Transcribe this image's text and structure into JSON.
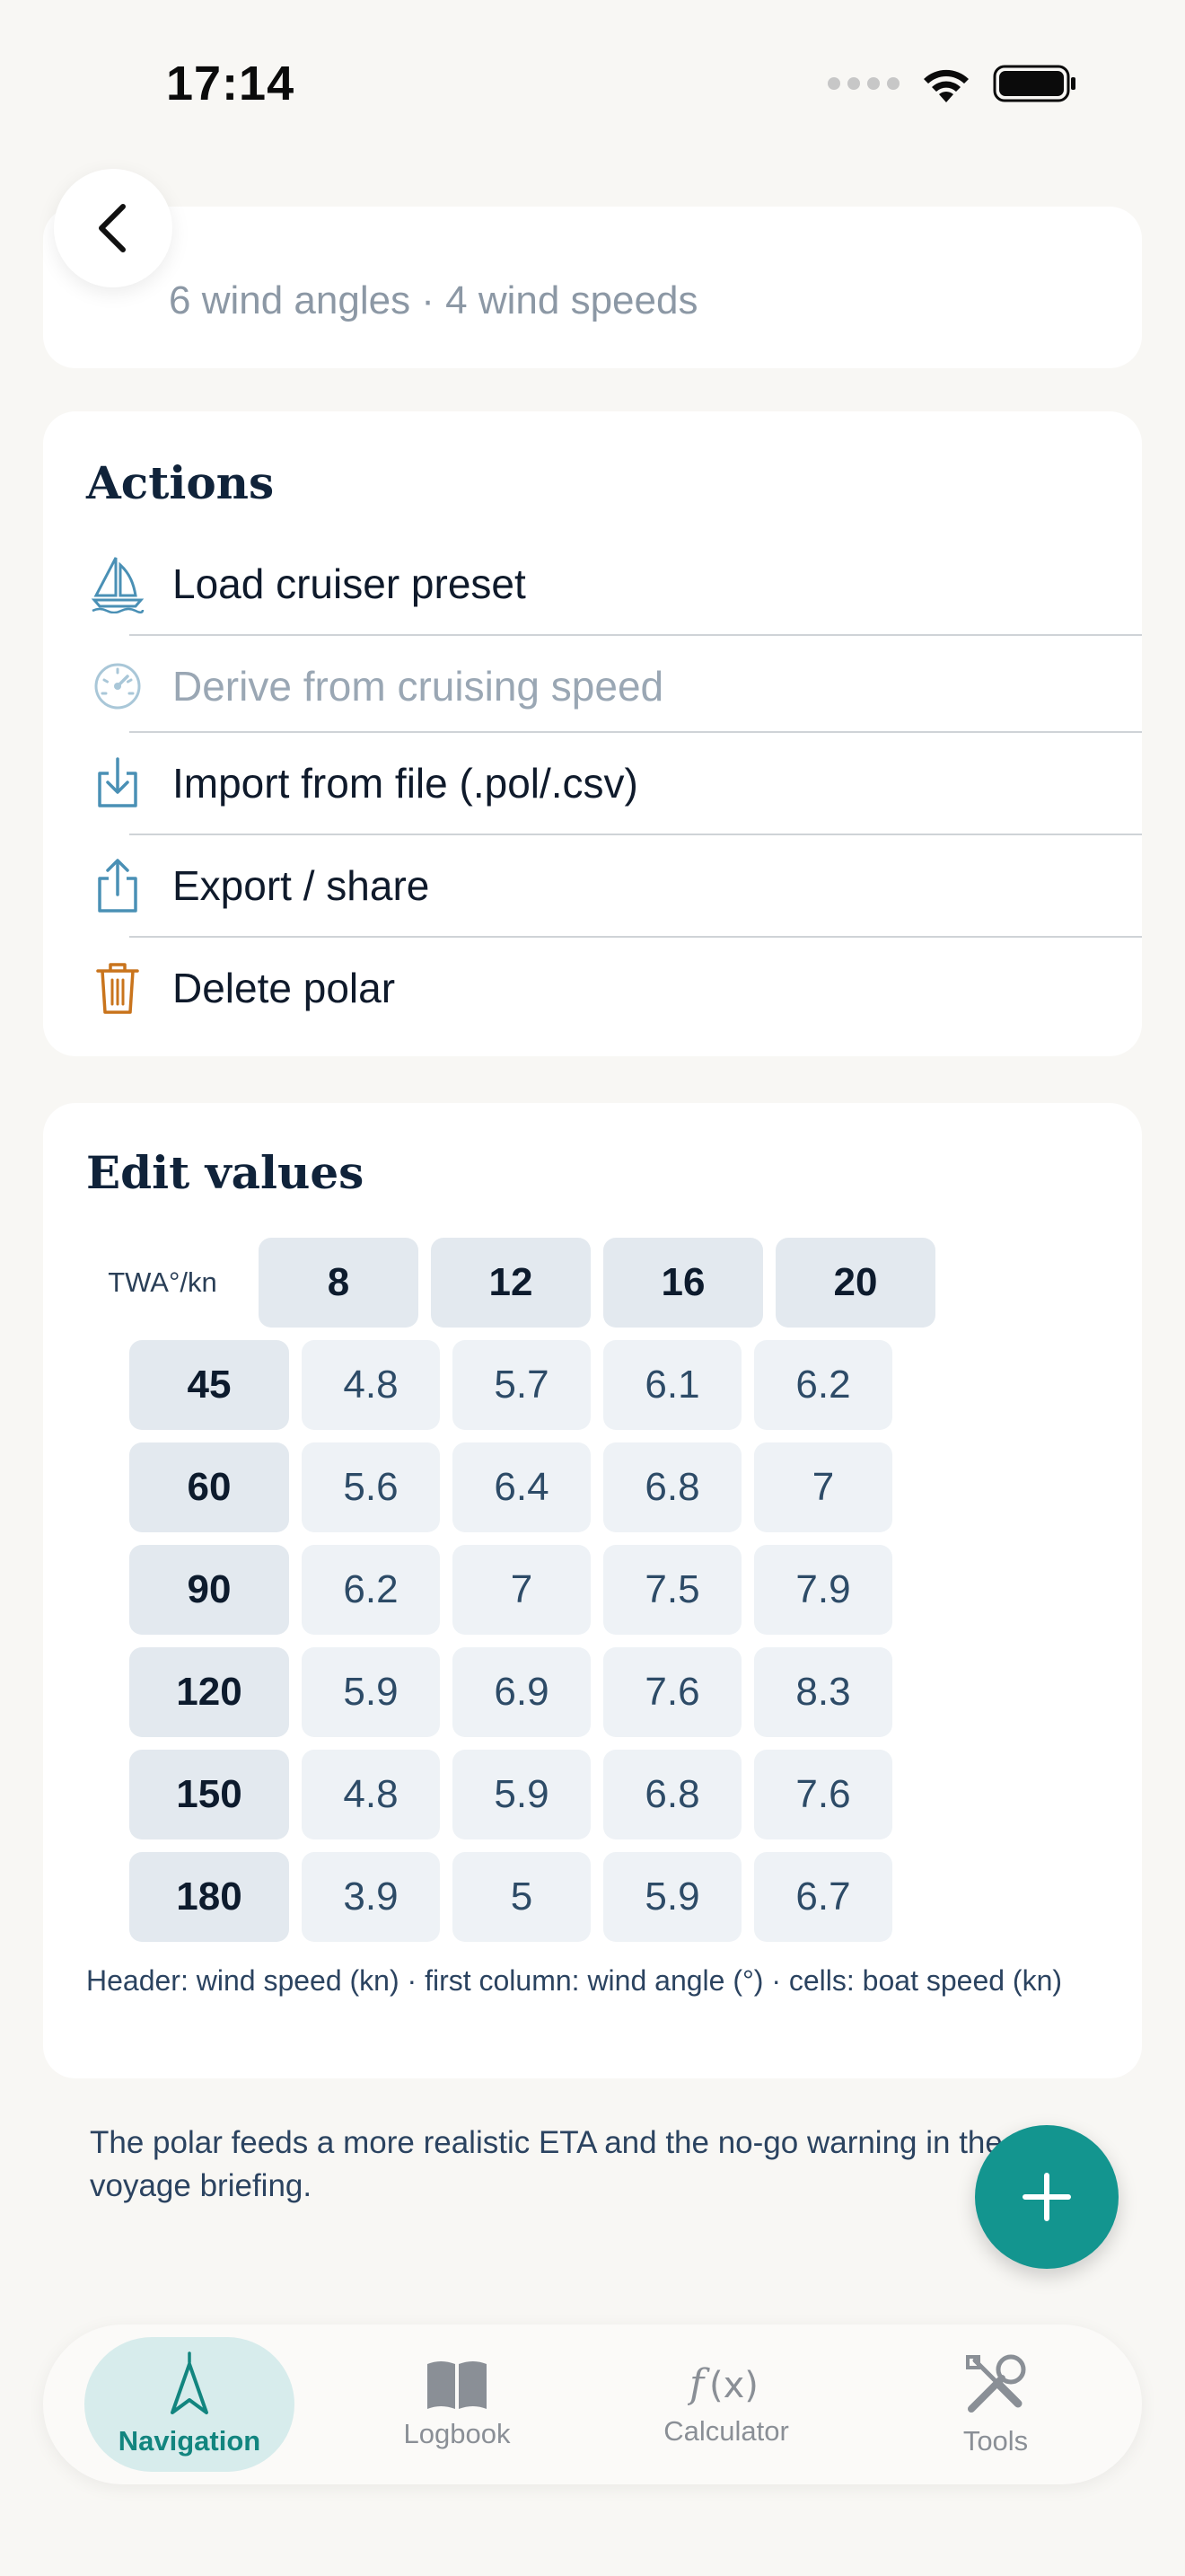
{
  "status": {
    "time": "17:14"
  },
  "top_card": {
    "text": "6 wind angles · 4 wind speeds"
  },
  "actions": {
    "title": "Actions",
    "items": [
      {
        "label": "Load cruiser preset",
        "icon": "sailboat-icon",
        "enabled": true
      },
      {
        "label": "Derive from cruising speed",
        "icon": "gauge-icon",
        "enabled": false
      },
      {
        "label": "Import from file (.pol/.csv)",
        "icon": "import-icon",
        "enabled": true
      },
      {
        "label": "Export / share",
        "icon": "share-icon",
        "enabled": true
      },
      {
        "label": "Delete polar",
        "icon": "trash-icon",
        "enabled": true
      }
    ]
  },
  "edit": {
    "title": "Edit values",
    "corner_label": "TWA°/kn",
    "wind_speeds": [
      "8",
      "12",
      "16",
      "20"
    ],
    "rows": [
      {
        "angle": "45",
        "values": [
          "4.8",
          "5.7",
          "6.1",
          "6.2"
        ]
      },
      {
        "angle": "60",
        "values": [
          "5.6",
          "6.4",
          "6.8",
          "7"
        ]
      },
      {
        "angle": "90",
        "values": [
          "6.2",
          "7",
          "7.5",
          "7.9"
        ]
      },
      {
        "angle": "120",
        "values": [
          "5.9",
          "6.9",
          "7.6",
          "8.3"
        ]
      },
      {
        "angle": "150",
        "values": [
          "4.8",
          "5.9",
          "6.8",
          "7.6"
        ]
      },
      {
        "angle": "180",
        "values": [
          "3.9",
          "5",
          "5.9",
          "6.7"
        ]
      }
    ],
    "legend": "Header: wind speed (kn) · first column: wind angle (°) · cells: boat speed (kn)"
  },
  "footer_note": "The polar feeds a more realistic ETA and the no-go warning in the voyage briefing.",
  "tabs": [
    {
      "label": "Navigation",
      "icon": "navigation-arrow-icon",
      "active": true
    },
    {
      "label": "Logbook",
      "icon": "book-icon",
      "active": false
    },
    {
      "label": "Calculator",
      "icon": "function-icon",
      "active": false
    },
    {
      "label": "Tools",
      "icon": "tools-icon",
      "active": false
    }
  ],
  "colors": {
    "accent": "#13958f",
    "danger_icon": "#c9741c",
    "action_icon": "#4a90b5"
  }
}
